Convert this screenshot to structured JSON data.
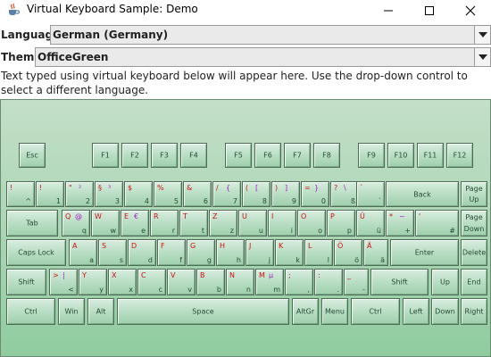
{
  "window": {
    "title": "Virtual Keyboard Sample: Demo",
    "icon": "java-cup-icon"
  },
  "language": {
    "label": "Language",
    "value": "German (Germany)"
  },
  "theme": {
    "label": "Theme",
    "value": "OfficeGreen"
  },
  "typed_area": {
    "text": "Text typed using virtual keyboard below will appear here. Use the drop-down control to select a different language."
  },
  "colors": {
    "keyboard_bg": "#a9d5b3",
    "key_text": "#244b33",
    "shift_text": "#cc1111",
    "altgr_text": "#a020c0"
  },
  "keyboard": {
    "function_row": [
      "Esc",
      "F1",
      "F2",
      "F3",
      "F4",
      "F5",
      "F6",
      "F7",
      "F8",
      "F9",
      "F10",
      "F11",
      "F12"
    ],
    "number_row": [
      {
        "shift": "!",
        "base": "^"
      },
      {
        "shift": "!",
        "base": "1"
      },
      {
        "shift": "\"",
        "base": "2",
        "altgr": "²"
      },
      {
        "shift": "§",
        "base": "3",
        "altgr": "³"
      },
      {
        "shift": "$",
        "base": "4"
      },
      {
        "shift": "%",
        "base": "5"
      },
      {
        "shift": "&",
        "base": "6"
      },
      {
        "shift": "/",
        "base": "7",
        "altgr": "{"
      },
      {
        "shift": "(",
        "base": "8",
        "altgr": "["
      },
      {
        "shift": ")",
        "base": "9",
        "altgr": "]"
      },
      {
        "shift": "=",
        "base": "0",
        "altgr": "}"
      },
      {
        "shift": "?",
        "base": "ß",
        "altgr": "\\"
      },
      {
        "shift": "`",
        "base": "´"
      }
    ],
    "back": "Back",
    "page_up": [
      "Page",
      "Up"
    ],
    "tab": "Tab",
    "qwertz_row": [
      {
        "shift": "Q",
        "base": "q",
        "altgr": "@"
      },
      {
        "shift": "W",
        "base": "w"
      },
      {
        "shift": "E",
        "base": "e",
        "altgr": "€"
      },
      {
        "shift": "R",
        "base": "r"
      },
      {
        "shift": "T",
        "base": "t"
      },
      {
        "shift": "Z",
        "base": "z"
      },
      {
        "shift": "U",
        "base": "u"
      },
      {
        "shift": "I",
        "base": "i"
      },
      {
        "shift": "O",
        "base": "o"
      },
      {
        "shift": "P",
        "base": "p"
      },
      {
        "shift": "Ü",
        "base": "ü"
      },
      {
        "shift": "*",
        "base": "+",
        "altgr": "~"
      },
      {
        "shift": "'",
        "base": "#"
      }
    ],
    "page_down": [
      "Page",
      "Down"
    ],
    "caps_lock": "Caps Lock",
    "asdf_row": [
      {
        "shift": "A",
        "base": "a"
      },
      {
        "shift": "S",
        "base": "s"
      },
      {
        "shift": "D",
        "base": "d"
      },
      {
        "shift": "F",
        "base": "f"
      },
      {
        "shift": "G",
        "base": "g"
      },
      {
        "shift": "H",
        "base": "h"
      },
      {
        "shift": "J",
        "base": "j"
      },
      {
        "shift": "K",
        "base": "k"
      },
      {
        "shift": "L",
        "base": "l"
      },
      {
        "shift": "Ö",
        "base": "ö"
      },
      {
        "shift": "Ä",
        "base": "ä"
      }
    ],
    "enter": "Enter",
    "delete": "Delete",
    "shift": "Shift",
    "yxcv_row": [
      {
        "shift": ">",
        "base": "<",
        "altgr": "|"
      },
      {
        "shift": "Y",
        "base": "y"
      },
      {
        "shift": "X",
        "base": "x"
      },
      {
        "shift": "C",
        "base": "c"
      },
      {
        "shift": "V",
        "base": "v"
      },
      {
        "shift": "B",
        "base": "b"
      },
      {
        "shift": "N",
        "base": "n"
      },
      {
        "shift": "M",
        "base": "m",
        "altgr": "µ"
      },
      {
        "shift": ";",
        "base": ","
      },
      {
        "shift": ":",
        "base": "."
      },
      {
        "shift": "_",
        "base": "-"
      }
    ],
    "up": "Up",
    "end": "End",
    "bottom_row": [
      "Ctrl",
      "Win",
      "Alt",
      "Space",
      "AltGr",
      "Menu",
      "Ctrl",
      "Left",
      "Down",
      "Right"
    ]
  }
}
